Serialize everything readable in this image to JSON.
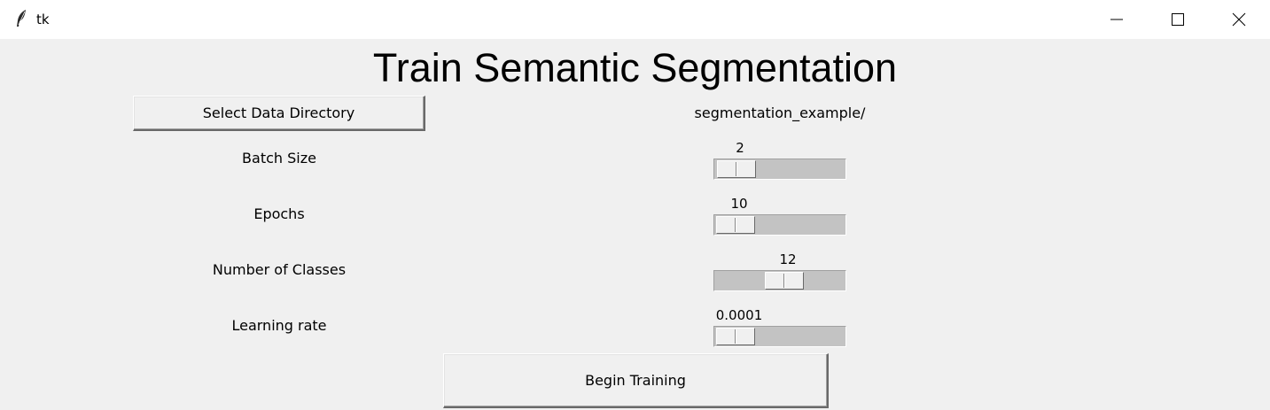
{
  "window": {
    "title": "tk"
  },
  "heading": "Train Semantic Segmentation",
  "select_button_label": "Select Data Directory",
  "data_directory": "segmentation_example/",
  "settings": {
    "batch_size": {
      "label": "Batch Size",
      "value": "2",
      "fraction": 0.02
    },
    "epochs": {
      "label": "Epochs",
      "value": "10",
      "fraction": 0.01
    },
    "num_classes": {
      "label": "Number of Classes",
      "value": "12",
      "fraction": 0.55
    },
    "learning_rate": {
      "label": "Learning rate",
      "value": "0.0001",
      "fraction": 0.01
    }
  },
  "begin_button_label": "Begin Training",
  "icons": {
    "app": "feather-icon",
    "minimize": "minimize-icon",
    "maximize": "maximize-icon",
    "close": "close-icon"
  }
}
